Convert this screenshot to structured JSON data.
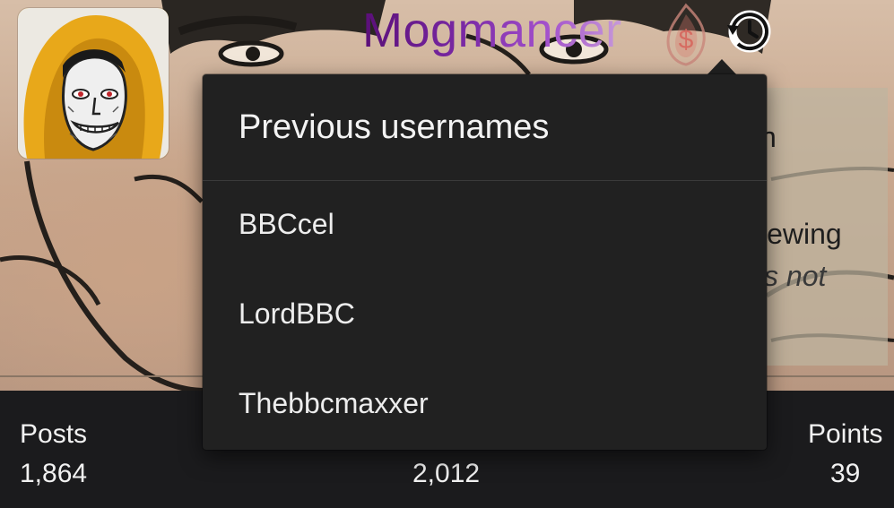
{
  "profile": {
    "username": "Mogmancer",
    "donor_icon": "dollar-flame-icon",
    "history_icon": "history-icon",
    "username_gradient": [
      "#5a0f78",
      "#c79ad9"
    ]
  },
  "banner_fragments": {
    "line1": "n",
    "line2": "iewing",
    "line3": "s not"
  },
  "popup": {
    "title": "Previous usernames",
    "items": [
      {
        "label": "BBCcel"
      },
      {
        "label": "LordBBC"
      },
      {
        "label": "Thebbcmaxxer"
      }
    ]
  },
  "stats": {
    "posts": {
      "label": "Posts",
      "value": "1,864"
    },
    "middle": {
      "value": "2,012"
    },
    "points": {
      "label": "Points",
      "value": "39"
    }
  },
  "colors": {
    "popup_bg": "#212121",
    "page_bg": "#1b1b1d",
    "avatar_hood": "#e8a81a"
  }
}
